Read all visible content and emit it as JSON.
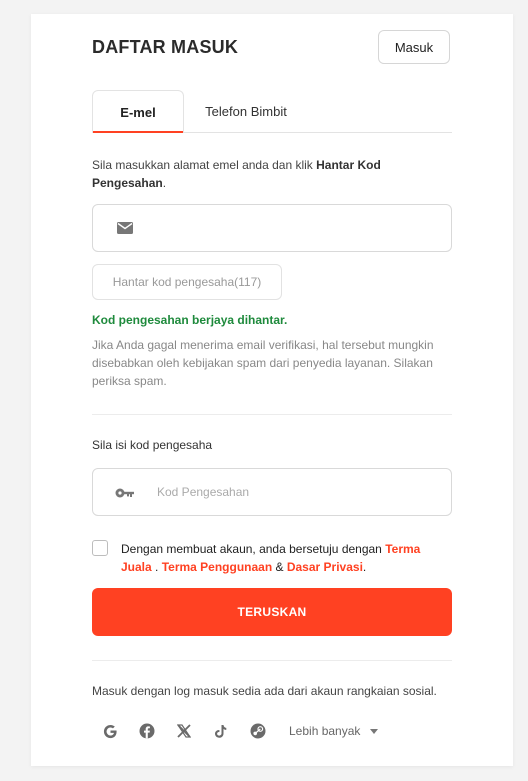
{
  "header": {
    "title": "DAFTAR MASUK",
    "login_label": "Masuk"
  },
  "tabs": [
    {
      "label": "E-mel",
      "active": true
    },
    {
      "label": "Telefon Bimbit",
      "active": false
    }
  ],
  "email_section": {
    "instruction_prefix": "Sila masukkan alamat emel anda dan klik ",
    "instruction_bold": "Hantar Kod Pengesahan",
    "instruction_suffix": ".",
    "email_value": "",
    "send_code_label": "Hantar kod pengesaha(117)",
    "success_text": "Kod pengesahan berjaya dihantar.",
    "hint_text": "Jika Anda gagal menerima email verifikasi, hal tersebut mungkin disebabkan oleh kebijakan spam dari penyedia layanan. Silakan periksa spam."
  },
  "code_section": {
    "label": "Sila isi kod pengesaha",
    "placeholder": "Kod Pengesahan"
  },
  "terms": {
    "prefix": "Dengan membuat akaun, anda bersetuju dengan ",
    "link1": "Terma Juala",
    "sep1": " . ",
    "link2": "Terma Penggunaan",
    "sep2": " & ",
    "link3": "Dasar Privasi",
    "suffix": ".",
    "checked": false
  },
  "continue_label": "TERUSKAN",
  "social": {
    "text": "Masuk dengan log masuk sedia ada dari akaun rangkaian sosial.",
    "icons": [
      "google-icon",
      "facebook-icon",
      "x-icon",
      "tiktok-icon",
      "steam-icon"
    ],
    "more_label": "Lebih banyak"
  },
  "colors": {
    "accent": "#ff4122",
    "success": "#1e8a3c"
  }
}
